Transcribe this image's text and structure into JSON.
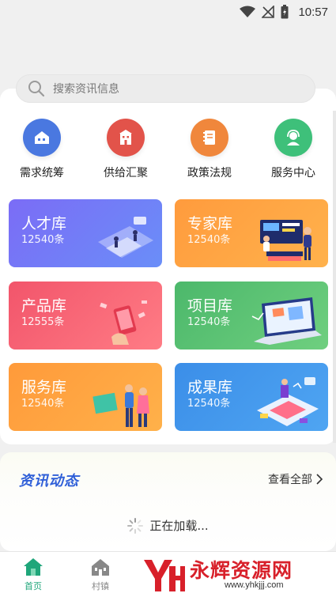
{
  "status_bar": {
    "time": "10:57"
  },
  "search": {
    "placeholder": "搜索资讯信息"
  },
  "quick_actions": [
    {
      "label": "需求统筹",
      "icon": "house-icon",
      "color": "#4a78e0"
    },
    {
      "label": "供给汇聚",
      "icon": "building-icon",
      "color": "#e2534a"
    },
    {
      "label": "政策法规",
      "icon": "book-icon",
      "color": "#f0873c"
    },
    {
      "label": "服务中心",
      "icon": "headset-icon",
      "color": "#3ec07a"
    }
  ],
  "tiles": [
    {
      "title": "人才库",
      "count": "12540条",
      "colors": [
        "#7b6cf6",
        "#6a8ef8"
      ]
    },
    {
      "title": "专家库",
      "count": "12540条",
      "colors": [
        "#ff9b3d",
        "#ffb24c"
      ]
    },
    {
      "title": "产品库",
      "count": "12555条",
      "colors": [
        "#f2556b",
        "#ff7c85"
      ]
    },
    {
      "title": "项目库",
      "count": "12540条",
      "colors": [
        "#4cb86b",
        "#6fcf7f"
      ]
    },
    {
      "title": "服务库",
      "count": "12540条",
      "colors": [
        "#ff9a3a",
        "#ffb14a"
      ]
    },
    {
      "title": "成果库",
      "count": "12540条",
      "colors": [
        "#3b8ee8",
        "#4fa5f2"
      ]
    }
  ],
  "news": {
    "title": "资讯动态",
    "more": "查看全部",
    "loading": "正在加载..."
  },
  "bottom_nav": [
    {
      "label": "首页",
      "icon": "home-icon",
      "active": true
    },
    {
      "label": "村镇",
      "icon": "village-icon",
      "active": false
    }
  ],
  "watermark": {
    "text": "永辉资源网",
    "url": "www.yhkjjj.com"
  }
}
